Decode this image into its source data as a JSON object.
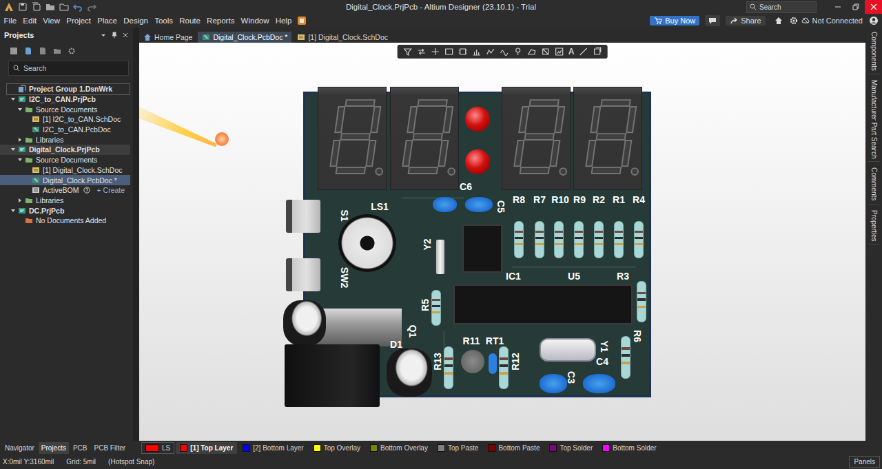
{
  "window": {
    "title": "Digital_Clock.PrjPcb - Altium Designer (23.10.1) - Trial",
    "search_placeholder": "Search"
  },
  "menu": [
    "File",
    "Edit",
    "View",
    "Project",
    "Place",
    "Design",
    "Tools",
    "Route",
    "Reports",
    "Window",
    "Help"
  ],
  "menu_right": {
    "buy": "Buy Now",
    "share": "Share",
    "connection": "Not Connected"
  },
  "projects_panel": {
    "title": "Projects",
    "search_placeholder": "Search",
    "tree": [
      {
        "label": "Project Group 1.DsnWrk",
        "depth": 0,
        "kind": "group",
        "expanded": true,
        "selected": false,
        "active": false
      },
      {
        "label": "I2C_to_CAN.PrjPcb",
        "depth": 1,
        "kind": "project",
        "expanded": true,
        "selected": false,
        "active": false
      },
      {
        "label": "Source Documents",
        "depth": 2,
        "kind": "folder",
        "expanded": true,
        "selected": false,
        "active": false
      },
      {
        "label": "[1] I2C_to_CAN.SchDoc",
        "depth": 3,
        "kind": "sch",
        "expanded": false,
        "selected": false,
        "active": false
      },
      {
        "label": "I2C_to_CAN.PcbDoc",
        "depth": 3,
        "kind": "pcb",
        "expanded": false,
        "selected": false,
        "active": false
      },
      {
        "label": "Libraries",
        "depth": 2,
        "kind": "folder",
        "expanded": false,
        "selected": false,
        "active": false
      },
      {
        "label": "Digital_Clock.PrjPcb",
        "depth": 1,
        "kind": "project",
        "expanded": true,
        "selected": false,
        "active": true
      },
      {
        "label": "Source Documents",
        "depth": 2,
        "kind": "folder",
        "expanded": true,
        "selected": false,
        "active": false
      },
      {
        "label": "[1] Digital_Clock.SchDoc",
        "depth": 3,
        "kind": "sch",
        "expanded": false,
        "selected": false,
        "active": false
      },
      {
        "label": "Digital_Clock.PcbDoc *",
        "depth": 3,
        "kind": "pcb",
        "expanded": false,
        "selected": true,
        "active": false
      },
      {
        "label": "ActiveBOM",
        "depth": 3,
        "kind": "bom",
        "expanded": false,
        "selected": false,
        "active": false,
        "action": "+ Create"
      },
      {
        "label": "Libraries",
        "depth": 2,
        "kind": "folder",
        "expanded": false,
        "selected": false,
        "active": false
      },
      {
        "label": "DC.PrjPcb",
        "depth": 1,
        "kind": "project",
        "expanded": true,
        "selected": false,
        "active": false
      },
      {
        "label": "No Documents Added",
        "depth": 2,
        "kind": "empty",
        "expanded": false,
        "selected": false,
        "active": false
      }
    ]
  },
  "doc_tabs": [
    {
      "label": "Home Page",
      "kind": "home",
      "selected": false
    },
    {
      "label": "Digital_Clock.PcbDoc *",
      "kind": "pcb",
      "selected": true
    },
    {
      "label": "[1] Digital_Clock.SchDoc",
      "kind": "sch",
      "selected": false
    }
  ],
  "canvas_toolbar": {
    "text_tool": "A"
  },
  "designators": [
    "LS1",
    "S1",
    "SW2",
    "Y2",
    "C6",
    "C5",
    "R8",
    "R7",
    "R10",
    "R9",
    "R2",
    "R1",
    "R4",
    "IC1",
    "U5",
    "R3",
    "R5",
    "Q1",
    "D1",
    "R11",
    "RT1",
    "R13",
    "R12",
    "Y1",
    "C4",
    "C3",
    "R6"
  ],
  "right_panels": [
    "Components",
    "Manufacturer Part Search",
    "Comments",
    "Properties"
  ],
  "panel_tabs": [
    {
      "label": "Navigator",
      "selected": false
    },
    {
      "label": "Projects",
      "selected": true
    },
    {
      "label": "PCB",
      "selected": false
    },
    {
      "label": "PCB Filter",
      "selected": false
    }
  ],
  "layers": [
    {
      "label": "LS",
      "color": "#ff0000",
      "selected": false
    },
    {
      "label": "[1] Top Layer",
      "color": "#ff0000",
      "selected": true
    },
    {
      "label": "[2] Bottom Layer",
      "color": "#0000ff",
      "selected": false
    },
    {
      "label": "Top Overlay",
      "color": "#ffff00",
      "selected": false
    },
    {
      "label": "Bottom Overlay",
      "color": "#808000",
      "selected": false
    },
    {
      "label": "Top Paste",
      "color": "#808080",
      "selected": false
    },
    {
      "label": "Bottom Paste",
      "color": "#800000",
      "selected": false
    },
    {
      "label": "Top Solder",
      "color": "#800080",
      "selected": false
    },
    {
      "label": "Bottom Solder",
      "color": "#ff00ff",
      "selected": false
    }
  ],
  "status_bar": {
    "coords": "X:0mil Y:3160mil",
    "grid": "Grid: 5mil",
    "snap": "(Hotspot Snap)",
    "panels": "Panels"
  }
}
